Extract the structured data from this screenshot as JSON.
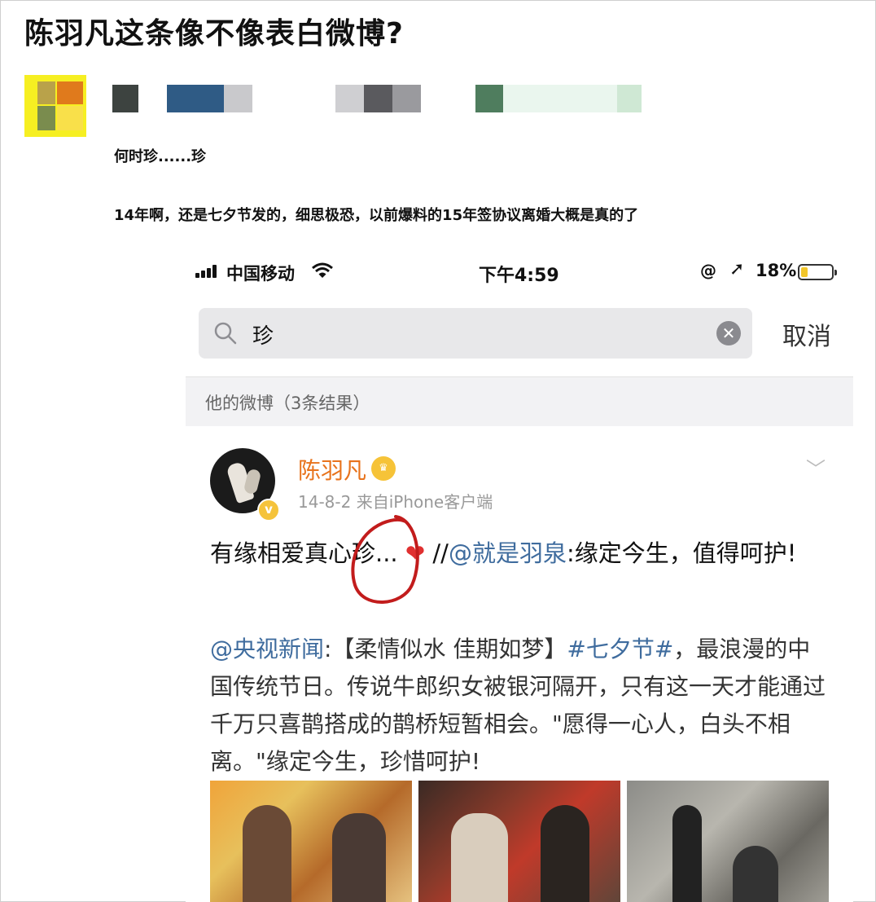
{
  "post_title": "陈羽凡这条像不像表白微博?",
  "caption_line1": "何时珍......珍",
  "caption_line2": "14年啊，还是七夕节发的，细思极恐，以前爆料的15年签协议离婚大概是真的了",
  "screenshot": {
    "status_bar": {
      "carrier": "中国移动",
      "time": "下午4:59",
      "battery": "18%",
      "battery_level": 0.18
    },
    "search": {
      "query": "珍",
      "cancel_label": "取消"
    },
    "results_label": "他的微博（3条结果）",
    "weibo": {
      "author": "陈羽凡",
      "date": "14-8-2",
      "source": "来自iPhone客户端",
      "text_a": "有缘相爱真心珍...",
      "heart": "❤",
      "text_b": " //",
      "mention": "@就是羽泉",
      "text_c": ":缘定今生，值得呵护!",
      "repost": {
        "mention": "@央视新闻",
        "text_a": ":【柔情似水 佳期如梦】",
        "topic": "#七夕节#",
        "text_b": "，最浪漫的中国传统节日。传说牛郎织女被银河隔开，只有这一天才能通过千万只喜鹊搭成的鹊桥短暂相会。\"愿得一心人，白头不相离。\"缘定今生，珍惜呵护!"
      }
    }
  }
}
